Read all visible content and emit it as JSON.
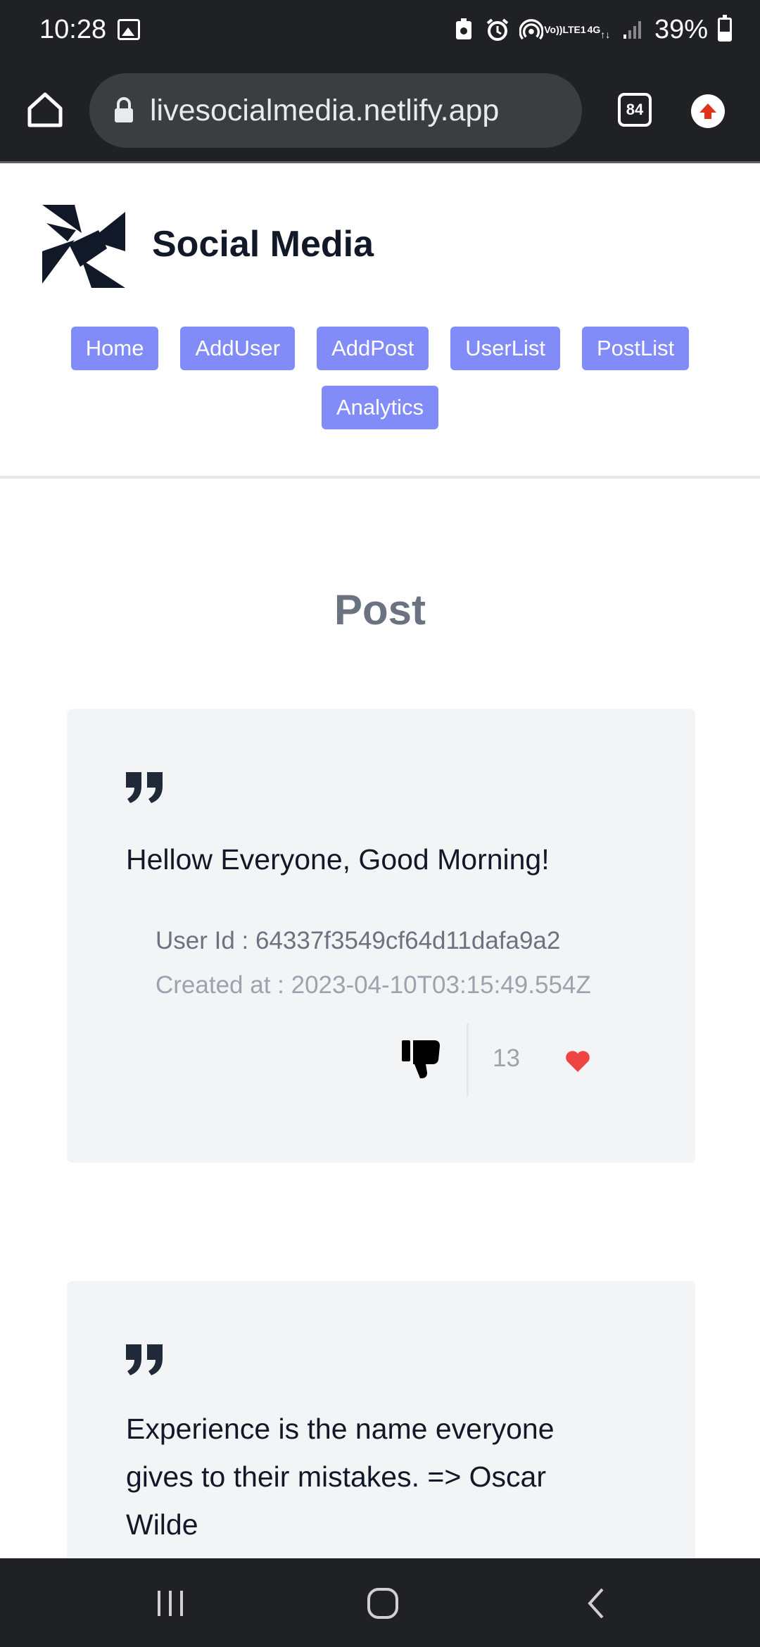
{
  "status_bar": {
    "time": "10:28",
    "battery": "39%",
    "network_top": "Vo))",
    "network_bottom": "LTE1",
    "gen": "4G"
  },
  "browser": {
    "url": "livesocialmedia.netlify.app",
    "tab_count": "84"
  },
  "site": {
    "title": "Social Media",
    "nav": [
      "Home",
      "AddUser",
      "AddPost",
      "UserList",
      "PostList",
      "Analytics"
    ]
  },
  "main": {
    "title": "Post",
    "posts": [
      {
        "text": "Hellow Everyone, Good Morning!",
        "user_id": "User Id : 64337f3549cf64d11dafa9a2",
        "created_at": "Created at : 2023-04-10T03:15:49.554Z",
        "likes": "13"
      },
      {
        "text": "Experience is the name everyone gives to their mistakes. => Oscar Wilde"
      }
    ]
  },
  "colors": {
    "accent": "#818cf8",
    "like": "#ef4444",
    "card_bg": "#f3f4f6"
  }
}
